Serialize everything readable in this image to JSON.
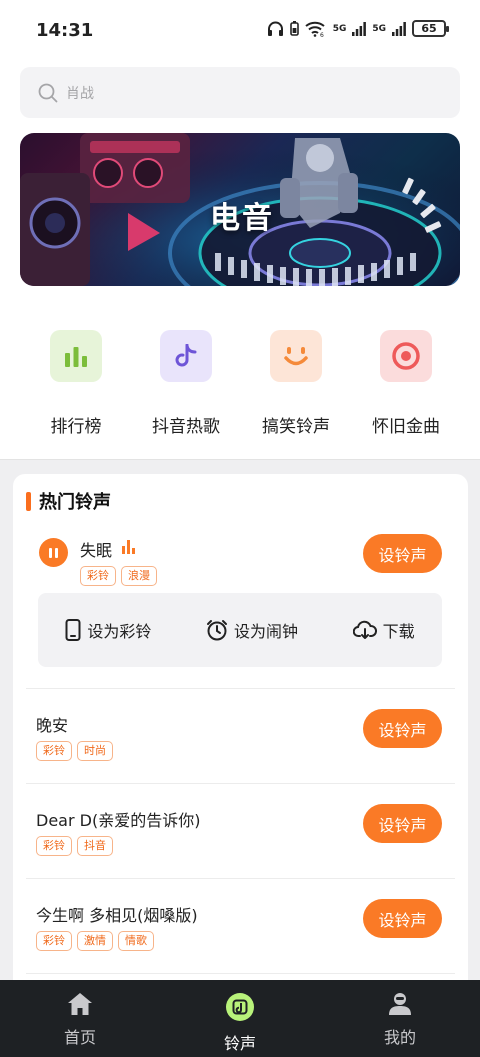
{
  "status_bar": {
    "time": "14:31",
    "net_a": "5G",
    "net_b": "5G",
    "battery": "65"
  },
  "search": {
    "placeholder": "肖战"
  },
  "banner": {
    "title": "电音"
  },
  "categories": [
    {
      "label": "排行榜",
      "icon": "bar-chart-icon",
      "bg": "#e7f4d9",
      "color": "#7cbd3b"
    },
    {
      "label": "抖音热歌",
      "icon": "tiktok-note-icon",
      "bg": "#e9e4fb",
      "color": "#6e55d7"
    },
    {
      "label": "搞笑铃声",
      "icon": "smile-icon",
      "bg": "#fde5d7",
      "color": "#f58a3a"
    },
    {
      "label": "怀旧金曲",
      "icon": "target-icon",
      "bg": "#fbdcdc",
      "color": "#ee5a5a"
    }
  ],
  "hot": {
    "title": "热门铃声",
    "set_label": "设铃声",
    "actions": {
      "set_ringtone": "设为彩铃",
      "set_alarm": "设为闹钟",
      "download": "下载"
    },
    "songs": [
      {
        "name": "失眠",
        "tags": [
          "彩铃",
          "浪漫"
        ],
        "playing": true
      },
      {
        "name": "晚安",
        "tags": [
          "彩铃",
          "时尚"
        ]
      },
      {
        "name": "Dear D(亲爱的告诉你)",
        "tags": [
          "彩铃",
          "抖音"
        ]
      },
      {
        "name": "今生啊 多相见(烟嗓版)",
        "tags": [
          "彩铃",
          "激情",
          "情歌"
        ]
      }
    ]
  },
  "tabs": [
    {
      "label": "首页",
      "icon": "home-icon"
    },
    {
      "label": "铃声",
      "icon": "music-note-icon",
      "active": true
    },
    {
      "label": "我的",
      "icon": "user-icon"
    }
  ],
  "colors": {
    "accent": "#fa7a26",
    "tabbar": "#1e2124",
    "active_tab": "#b8f27a"
  }
}
